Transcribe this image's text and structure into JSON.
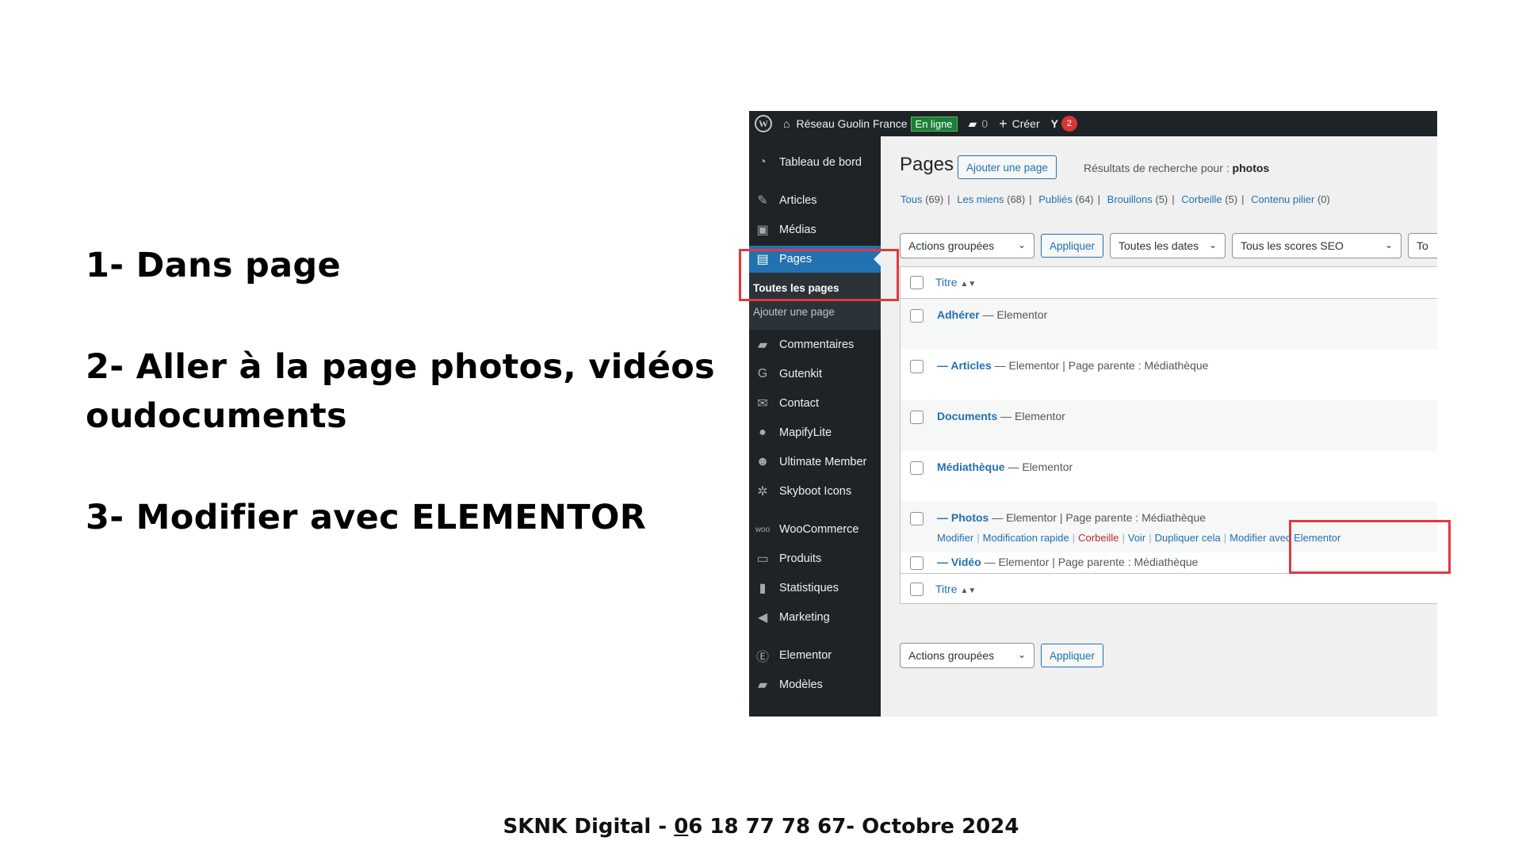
{
  "instructions": {
    "step1": "1- Dans page",
    "step2_line1": "2- Aller à la page photos, vidéos ou",
    "step2_line2": "documents",
    "step3": "3- Modifier avec ELEMENTOR"
  },
  "footer": {
    "prefix": "SKNK Digital - ",
    "underlined": "0",
    "rest": "6 18 77 78 67- Octobre 2024"
  },
  "adminbar": {
    "site_name": "Réseau Guolin France",
    "status_badge": "En ligne",
    "comments_count": "0",
    "create_label": "Créer",
    "seo_count": "2",
    "icons": [
      "wordpress-logo",
      "home-icon",
      "comment-icon",
      "plus-icon",
      "yoast-icon"
    ]
  },
  "sidebar": {
    "items": [
      {
        "label": "Tableau de bord",
        "icon": "dashboard-icon"
      },
      {
        "label": "Articles",
        "icon": "pin-icon"
      },
      {
        "label": "Médias",
        "icon": "media-icon"
      },
      {
        "label": "Pages",
        "icon": "pages-icon"
      },
      {
        "label": "Commentaires",
        "icon": "comment-icon"
      },
      {
        "label": "Gutenkit",
        "icon": "gutenkit-icon"
      },
      {
        "label": "Contact",
        "icon": "mail-icon"
      },
      {
        "label": "MapifyLite",
        "icon": "location-icon"
      },
      {
        "label": "Ultimate Member",
        "icon": "user-icon"
      },
      {
        "label": "Skyboot Icons",
        "icon": "gear-icon"
      },
      {
        "label": "WooCommerce",
        "icon": "woo-icon"
      },
      {
        "label": "Produits",
        "icon": "archive-icon"
      },
      {
        "label": "Statistiques",
        "icon": "bar-chart-icon"
      },
      {
        "label": "Marketing",
        "icon": "megaphone-icon"
      },
      {
        "label": "Elementor",
        "icon": "elementor-icon"
      },
      {
        "label": "Modèles",
        "icon": "folder-icon"
      }
    ],
    "submenu": {
      "all_pages": "Toutes les pages",
      "add_page": "Ajouter une page"
    }
  },
  "main": {
    "title": "Pages",
    "add_button": "Ajouter une page",
    "search_prefix": "Résultats de recherche pour :",
    "search_term": "photos",
    "filters": [
      {
        "label": "Tous",
        "count": "(69)"
      },
      {
        "label": "Les miens",
        "count": "(68)"
      },
      {
        "label": "Publiés",
        "count": "(64)"
      },
      {
        "label": "Brouillons",
        "count": "(5)"
      },
      {
        "label": "Corbeille",
        "count": "(5)"
      },
      {
        "label": "Contenu pilier",
        "count": "(0)"
      }
    ],
    "bulk_actions": "Actions groupées",
    "apply": "Appliquer",
    "all_dates": "Toutes les dates",
    "all_seo_scores": "Tous les scores SEO",
    "truncated_select": "To",
    "column_title": "Titre",
    "rows": [
      {
        "prefix": "",
        "title": "Adhérer",
        "suffix": " — Elementor"
      },
      {
        "prefix": "— ",
        "title": "Articles",
        "suffix": " — Elementor | Page parente : Médiathèque"
      },
      {
        "prefix": "",
        "title": "Documents",
        "suffix": " — Elementor"
      },
      {
        "prefix": "",
        "title": "Médiathèque",
        "suffix": " — Elementor"
      },
      {
        "prefix": "— ",
        "title": "Photos",
        "suffix": " — Elementor | Page parente : Médiathèque"
      },
      {
        "prefix": "— ",
        "title": "Vidéo",
        "suffix": " — Elementor | Page parente : Médiathèque"
      }
    ],
    "row_actions": {
      "edit": "Modifier",
      "quick_edit": "Modification rapide",
      "trash": "Corbeille",
      "view": "Voir",
      "duplicate": "Dupliquer cela",
      "edit_elementor": "Modifier avec Elementor"
    }
  },
  "colors": {
    "admin_dark": "#1d2327",
    "wp_blue": "#2271b1",
    "highlight_red": "#e0393e"
  }
}
